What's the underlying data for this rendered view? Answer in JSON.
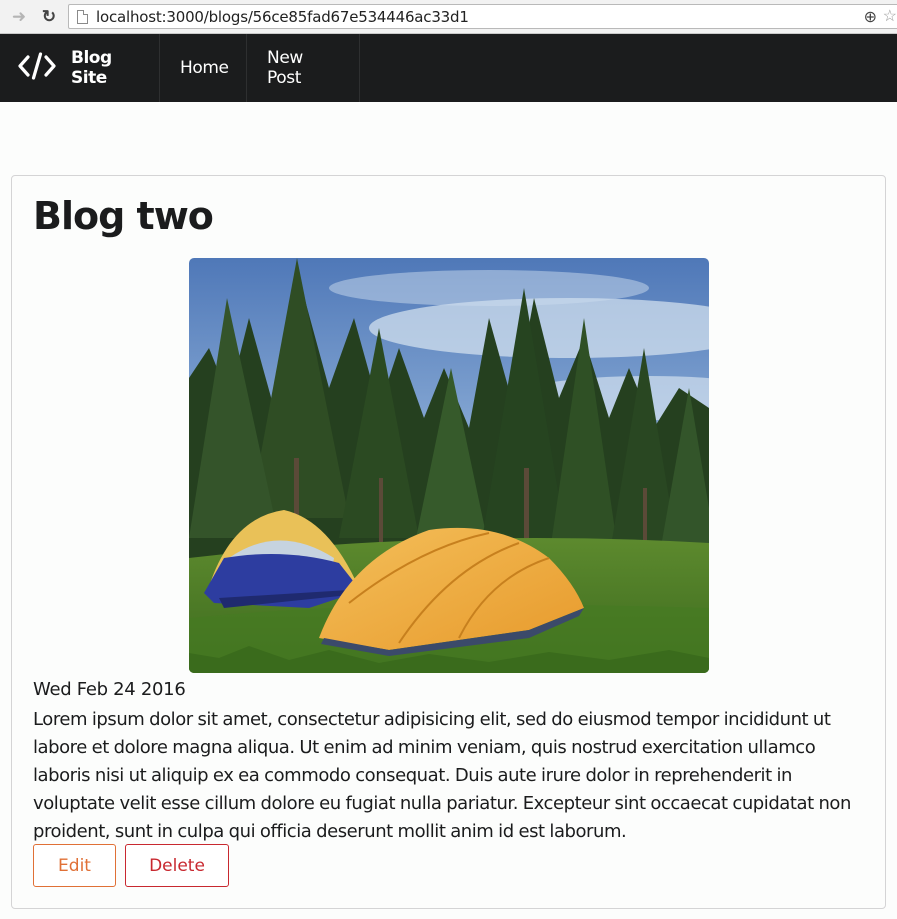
{
  "browser": {
    "url": "localhost:3000/blogs/56ce85fad67e534446ac33d1",
    "icons": [
      "forward-icon",
      "reload-icon",
      "page-icon",
      "zoom-icon",
      "star-icon"
    ]
  },
  "navbar": {
    "brand": "Blog Site",
    "brand_icon": "code-icon",
    "items": [
      {
        "label": "Home"
      },
      {
        "label": "New Post"
      }
    ]
  },
  "post": {
    "title": "Blog two",
    "image": "camping-tents-in-forest",
    "date": "Wed Feb 24 2016",
    "body": "Lorem ipsum dolor sit amet, consectetur adipisicing elit, sed do eiusmod tempor incididunt ut labore et dolore magna aliqua. Ut enim ad minim veniam, quis nostrud exercitation ullamco laboris nisi ut aliquip ex ea commodo consequat. Duis aute irure dolor in reprehenderit in voluptate velit esse cillum dolore eu fugiat nulla pariatur. Excepteur sint occaecat cupidatat non proident, sunt in culpa qui officia deserunt mollit anim id est laborum.",
    "edit_label": "Edit",
    "delete_label": "Delete"
  },
  "colors": {
    "navbar_bg": "#1b1c1d",
    "edit": "#e07036",
    "delete": "#c8282f"
  }
}
